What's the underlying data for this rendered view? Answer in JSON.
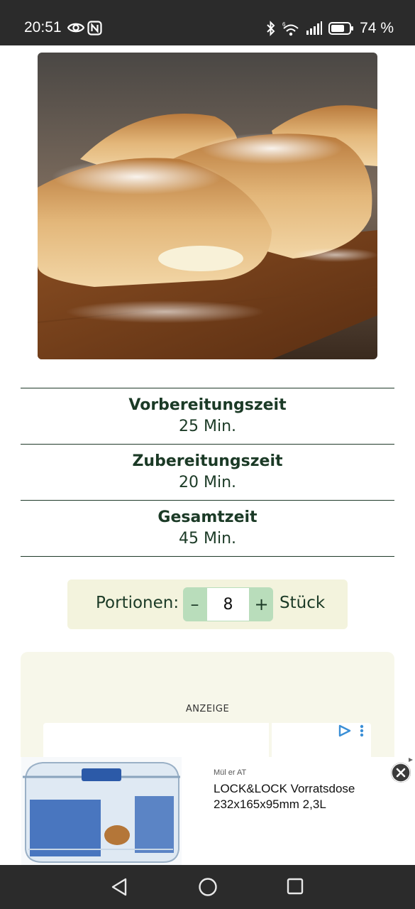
{
  "status_bar": {
    "time": "20:51",
    "battery": "74 %",
    "icons": [
      "eye-icon",
      "nfc-icon",
      "bluetooth-icon",
      "wifi-icon",
      "signal-icon",
      "battery-icon"
    ]
  },
  "hero": {
    "image": "puff-pastry-cream-filled-photo"
  },
  "times": [
    {
      "label": "Vorbereitungszeit",
      "value": "25 Min."
    },
    {
      "label": "Zubereitungszeit",
      "value": "20 Min."
    },
    {
      "label": "Gesamtzeit",
      "value": "45 Min."
    }
  ],
  "portions": {
    "label": "Portionen:",
    "decrement": "–",
    "value": "8",
    "increment": "+",
    "unit": "Stück"
  },
  "ad": {
    "label": "ANZEIGE"
  },
  "banner": {
    "seller": "Mül er AT",
    "title": "LOCK&LOCK Vorratsdose 232x165x95mm 2,3L"
  },
  "colors": {
    "accent_green": "#1b3a26",
    "stepper_green": "#b9ddbb",
    "portions_bg": "#f3f3dd",
    "ad_bg": "#f7f7ea",
    "system_bar": "#2b2b2b"
  }
}
